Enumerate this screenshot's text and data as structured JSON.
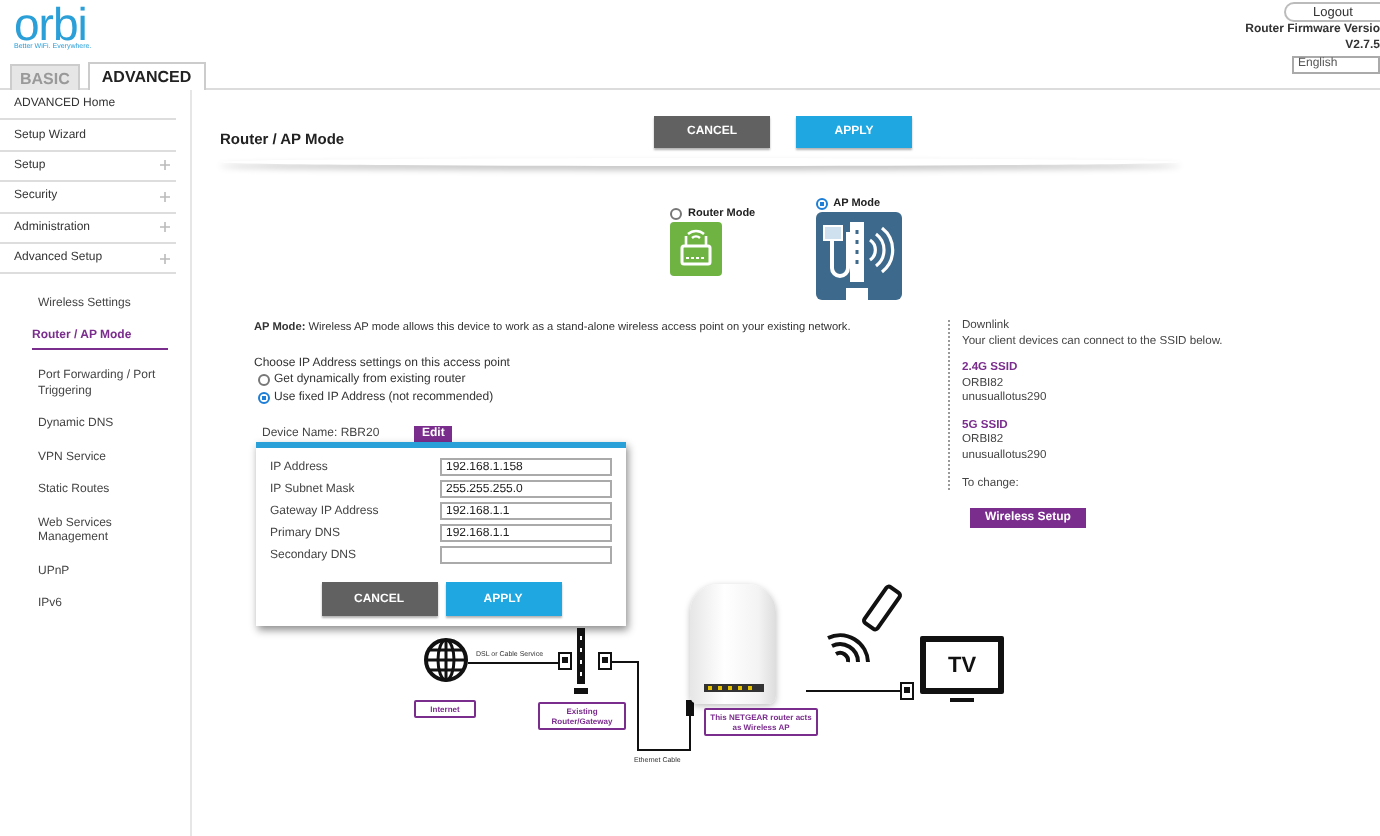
{
  "header": {
    "logo": "orbi",
    "tagline": "Better WiFi. Everywhere.",
    "tabs": [
      {
        "label": "BASIC",
        "selected": false
      },
      {
        "label": "ADVANCED",
        "selected": true
      }
    ],
    "logout": "Logout",
    "firmware_label": "Router Firmware Versio",
    "firmware_version": "V2.7.5",
    "language": "English"
  },
  "sidebar": {
    "items": [
      {
        "label": "ADVANCED Home",
        "expandable": false
      },
      {
        "label": "Setup Wizard",
        "expandable": false
      },
      {
        "label": "Setup",
        "expandable": true
      },
      {
        "label": "Security",
        "expandable": true
      },
      {
        "label": "Administration",
        "expandable": true
      },
      {
        "label": "Advanced Setup",
        "expandable": true
      }
    ],
    "sub_items": [
      {
        "label": "Wireless Settings",
        "selected": false
      },
      {
        "label": "Router / AP Mode",
        "selected": true
      },
      {
        "label": "Port Forwarding / Port Triggering",
        "selected": false
      },
      {
        "label": "Dynamic DNS",
        "selected": false
      },
      {
        "label": "VPN Service",
        "selected": false
      },
      {
        "label": "Static Routes",
        "selected": false
      },
      {
        "label": "Web Services Management",
        "selected": false
      },
      {
        "label": "UPnP",
        "selected": false
      },
      {
        "label": "IPv6",
        "selected": false
      }
    ]
  },
  "page": {
    "title": "Router / AP Mode",
    "buttons": [
      "CANCEL",
      "APPLY"
    ],
    "modes": [
      {
        "label": "Router Mode",
        "kind": "router",
        "selected": false
      },
      {
        "label": "AP Mode",
        "kind": "ap",
        "selected": true
      }
    ],
    "description": {
      "label": "AP Mode:",
      "text": "Wireless AP mode allows this device to work as a stand-alone wireless access point on your existing network."
    },
    "ip_settings": {
      "prompt": "Choose IP Address settings on this access point",
      "options": [
        {
          "label": "Get dynamically from existing router",
          "selected": false
        },
        {
          "label": "Use fixed IP Address (not recommended)",
          "selected": true
        }
      ]
    },
    "device": {
      "label": "Device Name: RBR20",
      "button": "Edit"
    },
    "ip_form": {
      "fields": [
        {
          "label": "IP Address",
          "value": "192.168.1.158"
        },
        {
          "label": "IP Subnet Mask",
          "value": "255.255.255.0"
        },
        {
          "label": "Gateway IP Address",
          "value": "192.168.1.1"
        },
        {
          "label": "Primary DNS",
          "value": "192.168.1.1"
        },
        {
          "label": "Secondary DNS"
        }
      ],
      "buttons": [
        "CANCEL",
        "APPLY"
      ]
    },
    "diagram": {
      "service": "DSL or Cable Service",
      "internet": "Internet",
      "gateway": "Existing Router/Gateway",
      "ap": "This NETGEAR router acts as Wireless AP",
      "cable": "Ethernet Cable",
      "tv": "TV"
    }
  },
  "downlink": {
    "heading": "Downlink",
    "note": "Your client devices can connect to the SSID below.",
    "ssids": [
      {
        "band": "2.4G SSID",
        "name": "ORBI82",
        "password": "unusuallotus290"
      },
      {
        "band": "5G SSID",
        "name": "ORBI82",
        "password": "unusuallotus290"
      }
    ],
    "change_label": "To change:",
    "button": "Wireless Setup"
  }
}
